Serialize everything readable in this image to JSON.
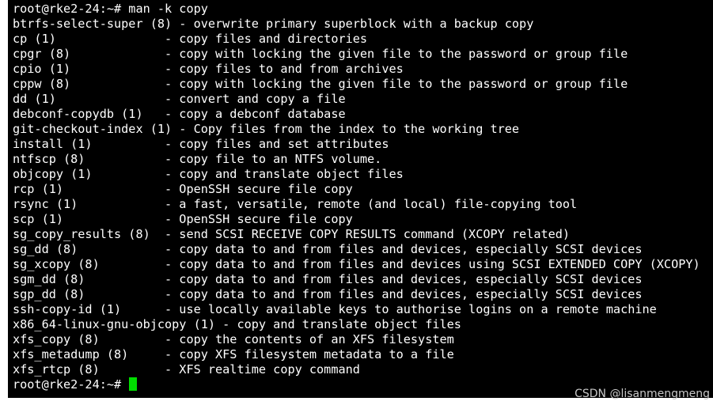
{
  "terminal": {
    "prompt_command": "root@rke2-24:~# man -k copy",
    "output": [
      "btrfs-select-super (8) - overwrite primary superblock with a backup copy",
      "cp (1)               - copy files and directories",
      "cpgr (8)             - copy with locking the given file to the password or group file",
      "cpio (1)             - copy files to and from archives",
      "cppw (8)             - copy with locking the given file to the password or group file",
      "dd (1)               - convert and copy a file",
      "debconf-copydb (1)   - copy a debconf database",
      "git-checkout-index (1) - Copy files from the index to the working tree",
      "install (1)          - copy files and set attributes",
      "ntfscp (8)           - copy file to an NTFS volume.",
      "objcopy (1)          - copy and translate object files",
      "rcp (1)              - OpenSSH secure file copy",
      "rsync (1)            - a fast, versatile, remote (and local) file-copying tool",
      "scp (1)              - OpenSSH secure file copy",
      "sg_copy_results (8)  - send SCSI RECEIVE COPY RESULTS command (XCOPY related)",
      "sg_dd (8)            - copy data to and from files and devices, especially SCSI devices",
      "sg_xcopy (8)         - copy data to and from files and devices using SCSI EXTENDED COPY (XCOPY)",
      "sgm_dd (8)           - copy data to and from files and devices, especially SCSI devices",
      "sgp_dd (8)           - copy data to and from files and devices, especially SCSI devices",
      "ssh-copy-id (1)      - use locally available keys to authorise logins on a remote machine",
      "x86_64-linux-gnu-objcopy (1) - copy and translate object files",
      "xfs_copy (8)         - copy the contents of an XFS filesystem",
      "xfs_metadump (8)     - copy XFS filesystem metadata to a file",
      "xfs_rtcp (8)         - XFS realtime copy command"
    ],
    "final_prompt": "root@rke2-24:~# "
  },
  "watermark": "CSDN @lisanmengmeng",
  "colors": {
    "background": "#000000",
    "text": "#ffffff",
    "cursor": "#00dd00"
  }
}
